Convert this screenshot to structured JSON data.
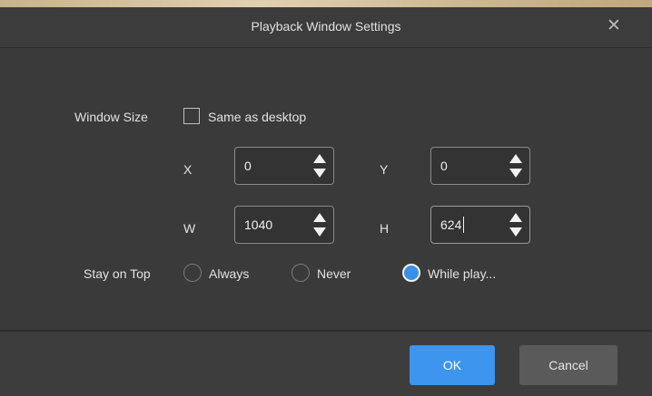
{
  "dialog": {
    "title": "Playback Window Settings",
    "close_icon": "close-icon"
  },
  "window_size": {
    "label": "Window Size",
    "same_as_desktop": {
      "label": "Same as desktop",
      "checked": false
    },
    "x": {
      "label": "X",
      "value": "0"
    },
    "y": {
      "label": "Y",
      "value": "0"
    },
    "w": {
      "label": "W",
      "value": "1040"
    },
    "h": {
      "label": "H",
      "value": "624"
    }
  },
  "stay_on_top": {
    "label": "Stay on Top",
    "options": [
      {
        "label": "Always",
        "checked": false
      },
      {
        "label": "Never",
        "checked": false
      },
      {
        "label": "While play...",
        "checked": true
      }
    ]
  },
  "footer": {
    "ok_label": "OK",
    "cancel_label": "Cancel"
  },
  "colors": {
    "accent": "#3d95ee",
    "background": "#3a3a3a",
    "cancel_button": "#5a5a5a"
  }
}
